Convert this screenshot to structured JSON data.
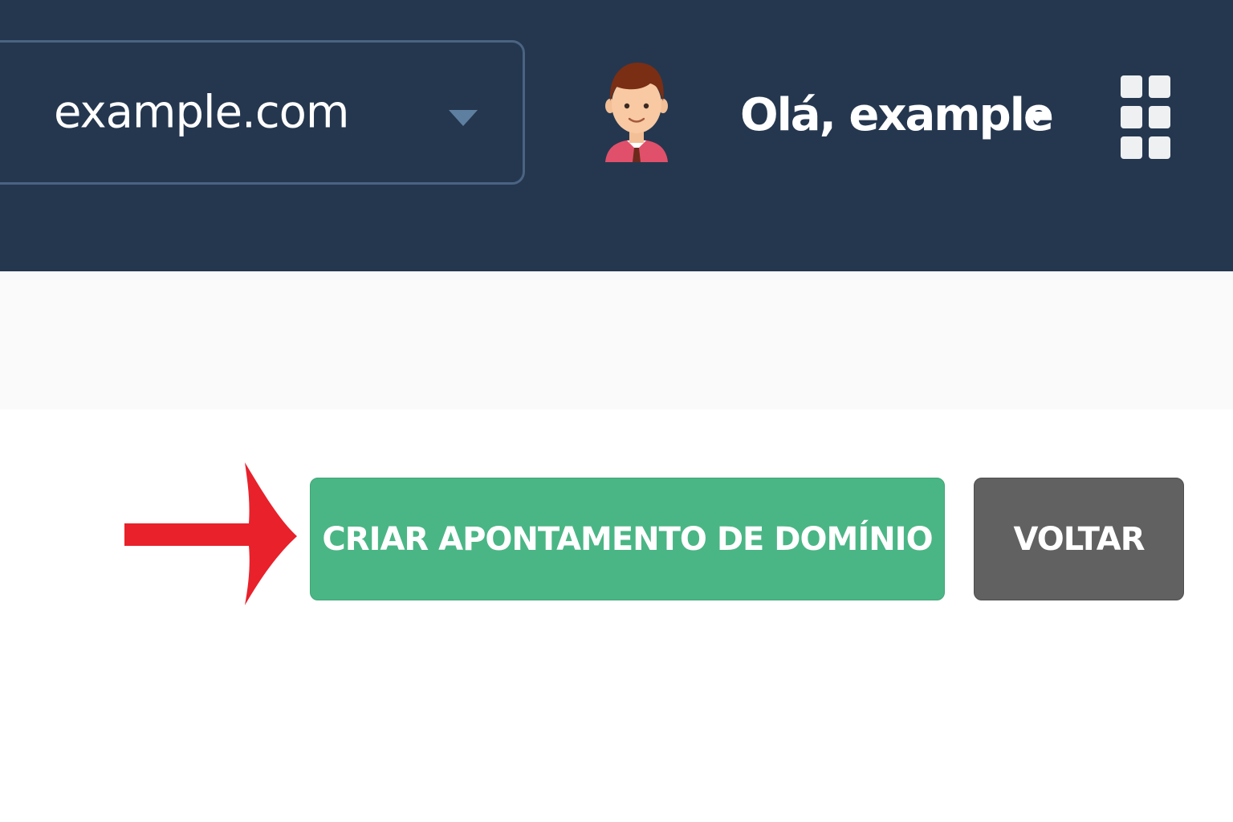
{
  "header": {
    "domain_select": {
      "value": "example.com",
      "caret_icon": "caret-down-icon"
    },
    "avatar_icon": "user-avatar-icon",
    "user_menu": {
      "greeting": "Olá, example",
      "caret_icon": "caret-down-icon"
    },
    "apps_icon": "apps-grid-icon"
  },
  "actions": {
    "create_label": "CRIAR APONTAMENTO DE DOMÍNIO",
    "back_label": "VOLTAR"
  },
  "annotation": {
    "arrow_icon": "red-arrow-icon"
  },
  "colors": {
    "header_bg": "#25374f",
    "primary_button": "#4ab685",
    "secondary_button": "#616161",
    "arrow": "#e8212b"
  }
}
